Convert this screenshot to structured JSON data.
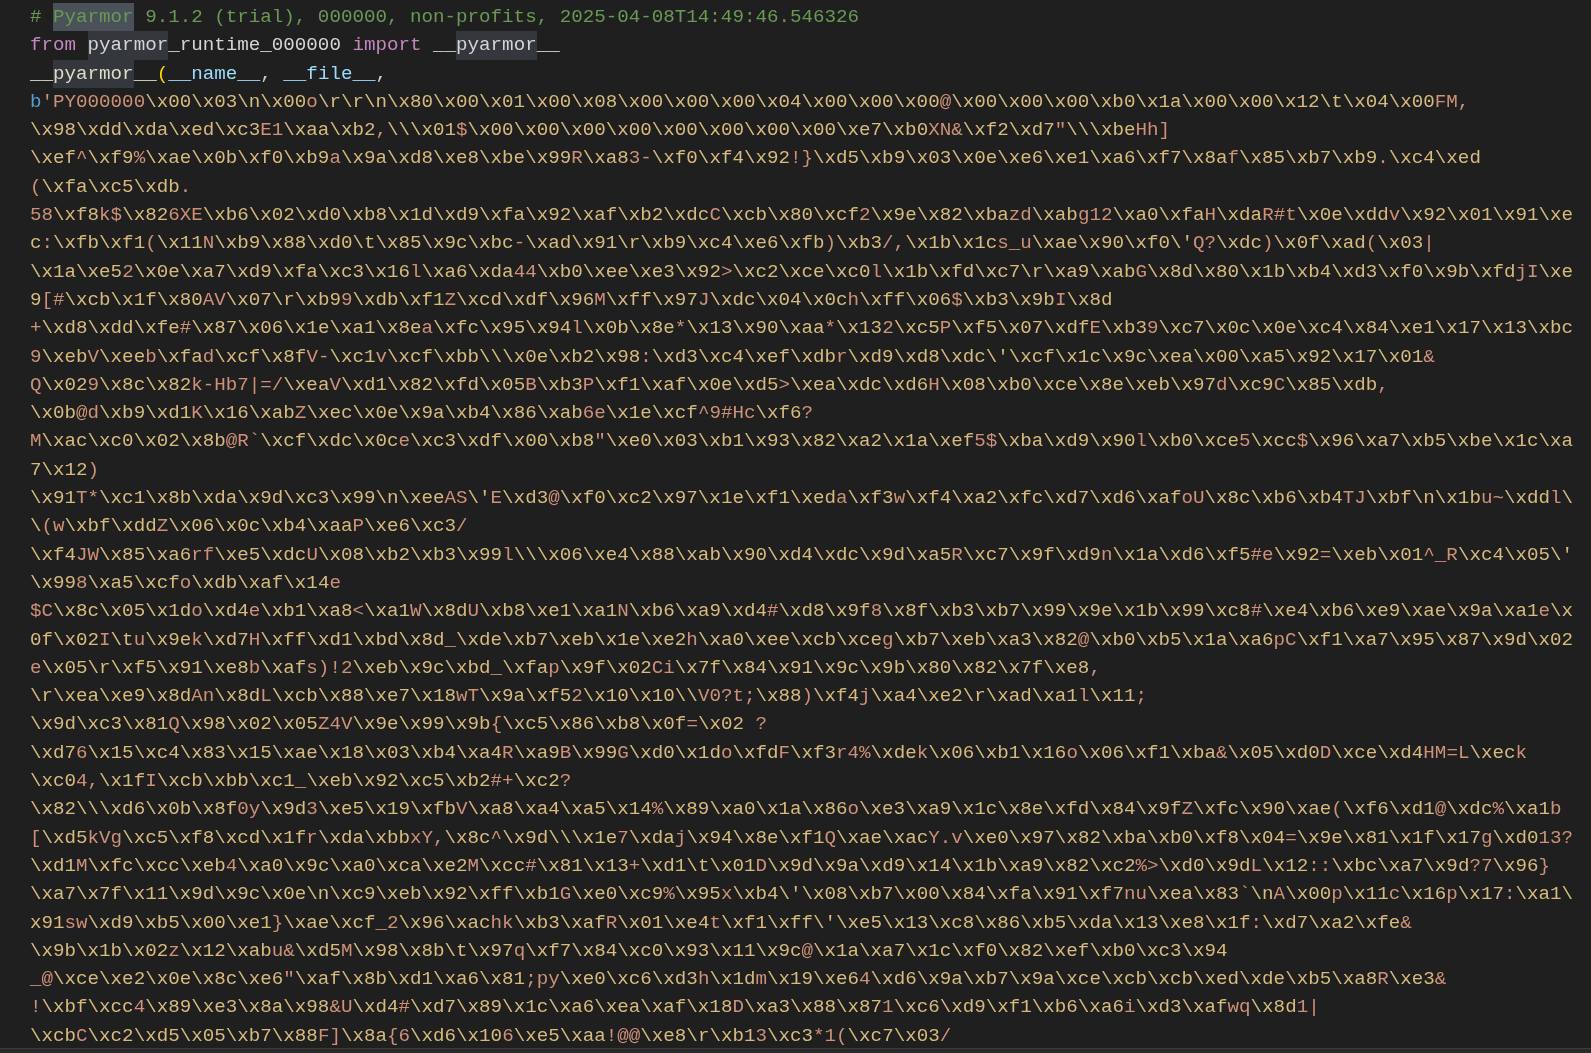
{
  "editor": {
    "lines": [
      {
        "tokens": [
          {
            "kind": "comment",
            "text": "# ",
            "highlighted": false
          },
          {
            "kind": "comment",
            "text": "Pyarmor",
            "highlighted": true,
            "current": true
          },
          {
            "kind": "comment",
            "text": " 9.1.2 (trial), 000000, non-profits, 2025-04-08T14:49:46.546326",
            "highlighted": false
          }
        ]
      },
      {
        "tokens": [
          {
            "kind": "keyword",
            "text": "from ",
            "highlighted": false
          },
          {
            "kind": "name",
            "text": "pyarmor",
            "highlighted": true,
            "current": false
          },
          {
            "kind": "name",
            "text": "_runtime_000000",
            "highlighted": false
          },
          {
            "kind": "keyword",
            "text": " import ",
            "highlighted": false
          },
          {
            "kind": "name",
            "text": "__",
            "highlighted": false
          },
          {
            "kind": "name",
            "text": "pyarmor",
            "highlighted": true,
            "current": false
          },
          {
            "kind": "name",
            "text": "__",
            "highlighted": false
          }
        ]
      },
      {
        "tokens": [
          {
            "kind": "function",
            "text": "__",
            "highlighted": false
          },
          {
            "kind": "function",
            "text": "pyarmor",
            "highlighted": true,
            "current": false
          },
          {
            "kind": "function",
            "text": "__",
            "highlighted": false
          },
          {
            "kind": "bracket",
            "text": "(",
            "highlighted": false
          },
          {
            "kind": "variable",
            "text": "__name__",
            "highlighted": false
          },
          {
            "kind": "punctuation",
            "text": ", ",
            "highlighted": false
          },
          {
            "kind": "variable",
            "text": "__file__",
            "highlighted": false
          },
          {
            "kind": "punctuation",
            "text": ",",
            "highlighted": false
          }
        ]
      },
      {
        "tokens": [
          {
            "kind": "prefix",
            "text": "b",
            "highlighted": false
          },
          {
            "kind": "string",
            "text": "'PY000000\\x00\\x03\\n\\x00o\\r\\r\\n\\x80\\x00\\x01\\x00\\x08\\x00\\x00\\x00\\x04\\x00\\x00\\x00@\\x00\\x00\\x00\\xb0\\x1a\\x00\\x00\\x12\\t\\x04\\x00FM,",
            "highlighted": false
          }
        ]
      },
      {
        "tokens": [
          {
            "kind": "string",
            "text": "\\x98\\xdd\\xda\\xed\\xc3E1\\xaa\\xb2,\\\\\\x01$\\x00\\x00\\x00\\x00\\x00\\x00\\x00\\x00\\xe7\\xb0XN&\\xf2\\xd7\"\\\\\\xbeHh]",
            "highlighted": false
          }
        ]
      },
      {
        "tokens": [
          {
            "kind": "string",
            "text": "\\xef^\\xf9%\\xae\\x0b\\xf0\\xb9a\\x9a\\xd8\\xe8\\xbe\\x99R\\xa83-\\xf0\\xf4\\x92!}\\xd5\\xb9\\x03\\x0e\\xe6\\xe1\\xa6\\xf7\\x8af\\x85\\xb7\\xb9.\\xc4\\xed",
            "highlighted": false
          }
        ]
      },
      {
        "tokens": [
          {
            "kind": "string",
            "text": "(\\xfa\\xc5\\xdb.",
            "highlighted": false
          }
        ]
      },
      {
        "tokens": [
          {
            "kind": "string",
            "text": "58\\xf8k$\\x826XE\\xb6\\x02\\xd0\\xb8\\x1d\\xd9\\xfa\\x92\\xaf\\xb2\\xdcC\\xcb\\x80\\xcf2\\x9e\\x82\\xbazd\\xabg12\\xa0\\xfaH\\xdaR#t\\x0e\\xddv\\x92\\x01\\x91\\xe",
            "highlighted": false
          }
        ]
      },
      {
        "tokens": [
          {
            "kind": "string",
            "text": "c:\\xfb\\xf1(\\x11N\\xb9\\x88\\xd0\\t\\x85\\x9c\\xbc-\\xad\\x91\\r\\xb9\\xc4\\xe6\\xfb)\\xb3/,\\x1b\\x1cs_u\\xae\\x90\\xf0\\'Q?\\xdc)\\x0f\\xad(\\x03|",
            "highlighted": false
          }
        ]
      },
      {
        "tokens": [
          {
            "kind": "string",
            "text": "\\x1a\\xe52\\x0e\\xa7\\xd9\\xfa\\xc3\\x16l\\xa6\\xda44\\xb0\\xee\\xe3\\x92>\\xc2\\xce\\xc0l\\x1b\\xfd\\xc7\\r\\xa9\\xabG\\x8d\\x80\\x1b\\xb4\\xd3\\xf0\\x9b\\xfdjI\\xe",
            "highlighted": false
          }
        ]
      },
      {
        "tokens": [
          {
            "kind": "string",
            "text": "9[#\\xcb\\x1f\\x80AV\\x07\\r\\xb99\\xdb\\xf1Z\\xcd\\xdf\\x96M\\xff\\x97J\\xdc\\x04\\x0ch\\xff\\x06$\\xb3\\x9bI\\x8d",
            "highlighted": false
          }
        ]
      },
      {
        "tokens": [
          {
            "kind": "string",
            "text": "+\\xd8\\xdd\\xfe#\\x87\\x06\\x1e\\xa1\\x8ea\\xfc\\x95\\x94l\\x0b\\x8e*\\x13\\x90\\xaa*\\x132\\xc5P\\xf5\\x07\\xdfE\\xb39\\xc7\\x0c\\x0e\\xc4\\x84\\xe1\\x17\\x13\\xbc",
            "highlighted": false
          }
        ]
      },
      {
        "tokens": [
          {
            "kind": "string",
            "text": "9\\xebV\\xeeb\\xfad\\xcf\\x8fV-\\xc1v\\xcf\\xbb\\\\\\x0e\\xb2\\x98:\\xd3\\xc4\\xef\\xdbr\\xd9\\xd8\\xdc\\'\\xcf\\x1c\\x9c\\xea\\x00\\xa5\\x92\\x17\\x01&",
            "highlighted": false
          }
        ]
      },
      {
        "tokens": [
          {
            "kind": "string",
            "text": "Q\\x029\\x8c\\x82k-Hb7|=/\\xeaV\\xd1\\x82\\xfd\\x05B\\xb3P\\xf1\\xaf\\x0e\\xd5>\\xea\\xdc\\xd6H\\x08\\xb0\\xce\\x8e\\xeb\\x97d\\xc9C\\x85\\xdb,",
            "highlighted": false
          }
        ]
      },
      {
        "tokens": [
          {
            "kind": "string",
            "text": "\\x0b@d\\xb9\\xd1K\\x16\\xabZ\\xec\\x0e\\x9a\\xb4\\x86\\xab6e\\x1e\\xcf^9#Hc\\xf6?",
            "highlighted": false
          }
        ]
      },
      {
        "tokens": [
          {
            "kind": "string",
            "text": "M\\xac\\xc0\\x02\\x8b@R`\\xcf\\xdc\\x0ce\\xc3\\xdf\\x00\\xb8\"\\xe0\\x03\\xb1\\x93\\x82\\xa2\\x1a\\xef5$\\xba\\xd9\\x90l\\xb0\\xce5\\xcc$\\x96\\xa7\\xb5\\xbe\\x1c\\xa",
            "highlighted": false
          }
        ]
      },
      {
        "tokens": [
          {
            "kind": "string",
            "text": "7\\x12)",
            "highlighted": false
          }
        ]
      },
      {
        "tokens": [
          {
            "kind": "string",
            "text": "\\x91T*\\xc1\\x8b\\xda\\x9d\\xc3\\x99\\n\\xeeAS\\'E\\xd3@\\xf0\\xc2\\x97\\x1e\\xf1\\xeda\\xf3w\\xf4\\xa2\\xfc\\xd7\\xd6\\xafoU\\x8c\\xb6\\xb4TJ\\xbf\\n\\x1bu~\\xddl\\",
            "highlighted": false
          }
        ]
      },
      {
        "tokens": [
          {
            "kind": "string",
            "text": "\\(w\\xbf\\xddZ\\x06\\x0c\\xb4\\xaaP\\xe6\\xc3/",
            "highlighted": false
          }
        ]
      },
      {
        "tokens": [
          {
            "kind": "string",
            "text": "\\xf4JW\\x85\\xa6rf\\xe5\\xdcU\\x08\\xb2\\xb3\\x99l\\\\\\x06\\xe4\\x88\\xab\\x90\\xd4\\xdc\\x9d\\xa5R\\xc7\\x9f\\xd9n\\x1a\\xd6\\xf5#e\\x92=\\xeb\\x01^_R\\xc4\\x05\\'",
            "highlighted": false
          }
        ]
      },
      {
        "tokens": [
          {
            "kind": "string",
            "text": "\\x998\\xa5\\xcfo\\xdb\\xaf\\x14e",
            "highlighted": false
          }
        ]
      },
      {
        "tokens": [
          {
            "kind": "string",
            "text": "$C\\x8c\\x05\\x1do\\xd4e\\xb1\\xa8<\\xa1W\\x8dU\\xb8\\xe1\\xa1N\\xb6\\xa9\\xd4#\\xd8\\x9f8\\x8f\\xb3\\xb7\\x99\\x9e\\x1b\\x99\\xc8#\\xe4\\xb6\\xe9\\xae\\x9a\\xa1e\\x",
            "highlighted": false
          }
        ]
      },
      {
        "tokens": [
          {
            "kind": "string",
            "text": "0f\\x02I\\tu\\x9ek\\xd7H\\xff\\xd1\\xbd\\x8d_\\xde\\xb7\\xeb\\x1e\\xe2h\\xa0\\xee\\xcb\\xceg\\xb7\\xeb\\xa3\\x82@\\xb0\\xb5\\x1a\\xa6pC\\xf1\\xa7\\x95\\x87\\x9d\\x02",
            "highlighted": false
          }
        ]
      },
      {
        "tokens": [
          {
            "kind": "string",
            "text": "e\\x05\\r\\xf5\\x91\\xe8b\\xafs)!2\\xeb\\x9c\\xbd_\\xfap\\x9f\\x02Ci\\x7f\\x84\\x91\\x9c\\x9b\\x80\\x82\\x7f\\xe8,",
            "highlighted": false
          }
        ]
      },
      {
        "tokens": [
          {
            "kind": "string",
            "text": "\\r\\xea\\xe9\\x8dAn\\x8dL\\xcb\\x88\\xe7\\x18wT\\x9a\\xf52\\x10\\x10\\\\V0?t;\\x88)\\xf4j\\xa4\\xe2\\r\\xad\\xa1l\\x11;",
            "highlighted": false
          }
        ]
      },
      {
        "tokens": [
          {
            "kind": "string",
            "text": "\\x9d\\xc3\\x81Q\\x98\\x02\\x05Z4V\\x9e\\x99\\x9b{\\xc5\\x86\\xb8\\x0f=\\x02 ?",
            "highlighted": false
          }
        ]
      },
      {
        "tokens": [
          {
            "kind": "string",
            "text": "\\xd76\\x15\\xc4\\x83\\x15\\xae\\x18\\x03\\xb4\\xa4R\\xa9B\\x99G\\xd0\\x1do\\xfdF\\xf3r4%\\xdek\\x06\\xb1\\x16o\\x06\\xf1\\xba&\\x05\\xd0D\\xce\\xd4HM=L\\xeck",
            "highlighted": false
          }
        ]
      },
      {
        "tokens": [
          {
            "kind": "string",
            "text": "\\xc04,\\x1fI\\xcb\\xbb\\xc1_\\xeb\\x92\\xc5\\xb2#+\\xc2?",
            "highlighted": false
          }
        ]
      },
      {
        "tokens": [
          {
            "kind": "string",
            "text": "\\x82\\\\\\xd6\\x0b\\x8f0y\\x9d3\\xe5\\x19\\xfbV\\xa8\\xa4\\xa5\\x14%\\x89\\xa0\\x1a\\x86o\\xe3\\xa9\\x1c\\x8e\\xfd\\x84\\x9fZ\\xfc\\x90\\xae(\\xf6\\xd1@\\xdc%\\xa1b",
            "highlighted": false
          }
        ]
      },
      {
        "tokens": [
          {
            "kind": "string",
            "text": "[\\xd5kVg\\xc5\\xf8\\xcd\\x1fr\\xda\\xbbxY,\\x8c^\\x9d\\\\\\x1e7\\xdaj\\x94\\x8e\\xf1Q\\xae\\xacY.v\\xe0\\x97\\x82\\xba\\xb0\\xf8\\x04=\\x9e\\x81\\x1f\\x17g\\xd013?",
            "highlighted": false
          }
        ]
      },
      {
        "tokens": [
          {
            "kind": "string",
            "text": "\\xd1M\\xfc\\xcc\\xeb4\\xa0\\x9c\\xa0\\xca\\xe2M\\xcc#\\x81\\x13+\\xd1\\t\\x01D\\x9d\\x9a\\xd9\\x14\\x1b\\xa9\\x82\\xc2%>\\xd0\\x9dL\\x12::\\xbc\\xa7\\x9d?7\\x96}",
            "highlighted": false
          }
        ]
      },
      {
        "tokens": [
          {
            "kind": "string",
            "text": "\\xa7\\x7f\\x11\\x9d\\x9c\\x0e\\n\\xc9\\xeb\\x92\\xff\\xb1G\\xe0\\xc9%\\x95x\\xb4\\'\\x08\\xb7\\x00\\x84\\xfa\\x91\\xf7nu\\xea\\x83`\\nA\\x00p\\x11c\\x16p\\x17:\\xa1\\",
            "highlighted": false
          }
        ]
      },
      {
        "tokens": [
          {
            "kind": "string",
            "text": "x91sw\\xd9\\xb5\\x00\\xe1}\\xae\\xcf_2\\x96\\xachk\\xb3\\xafR\\x01\\xe4t\\xf1\\xff\\'\\xe5\\x13\\xc8\\x86\\xb5\\xda\\x13\\xe8\\x1f:\\xd7\\xa2\\xfe&",
            "highlighted": false
          }
        ]
      },
      {
        "tokens": [
          {
            "kind": "string",
            "text": "\\x9b\\x1b\\x02z\\x12\\xabu&\\xd5M\\x98\\x8b\\t\\x97q\\xf7\\x84\\xc0\\x93\\x11\\x9c@\\x1a\\xa7\\x1c\\xf0\\x82\\xef\\xb0\\xc3\\x94",
            "highlighted": false
          }
        ]
      },
      {
        "tokens": [
          {
            "kind": "string",
            "text": "_@\\xce\\xe2\\x0e\\x8c\\xe6\"\\xaf\\x8b\\xd1\\xa6\\x81;py\\xe0\\xc6\\xd3h\\x1dm\\x19\\xe64\\xd6\\x9a\\xb7\\x9a\\xce\\xcb\\xcb\\xed\\xde\\xb5\\xa8R\\xe3&",
            "highlighted": false
          }
        ]
      },
      {
        "tokens": [
          {
            "kind": "string",
            "text": "!\\xbf\\xcc4\\x89\\xe3\\x8a\\x98&U\\xd4#\\xd7\\x89\\x1c\\xa6\\xea\\xaf\\x18D\\xa3\\x88\\x871\\xc6\\xd9\\xf1\\xb6\\xa6i\\xd3\\xafwq\\x8d1|",
            "highlighted": false
          }
        ]
      },
      {
        "tokens": [
          {
            "kind": "string",
            "text": "\\xcbC\\xc2\\xd5\\x05\\xb7\\x88F]\\x8a{6\\xd6\\x106\\xe5\\xaa!@@\\xe8\\r\\xb13\\xc3*1(\\xc7\\x03/",
            "highlighted": false
          }
        ]
      }
    ]
  }
}
